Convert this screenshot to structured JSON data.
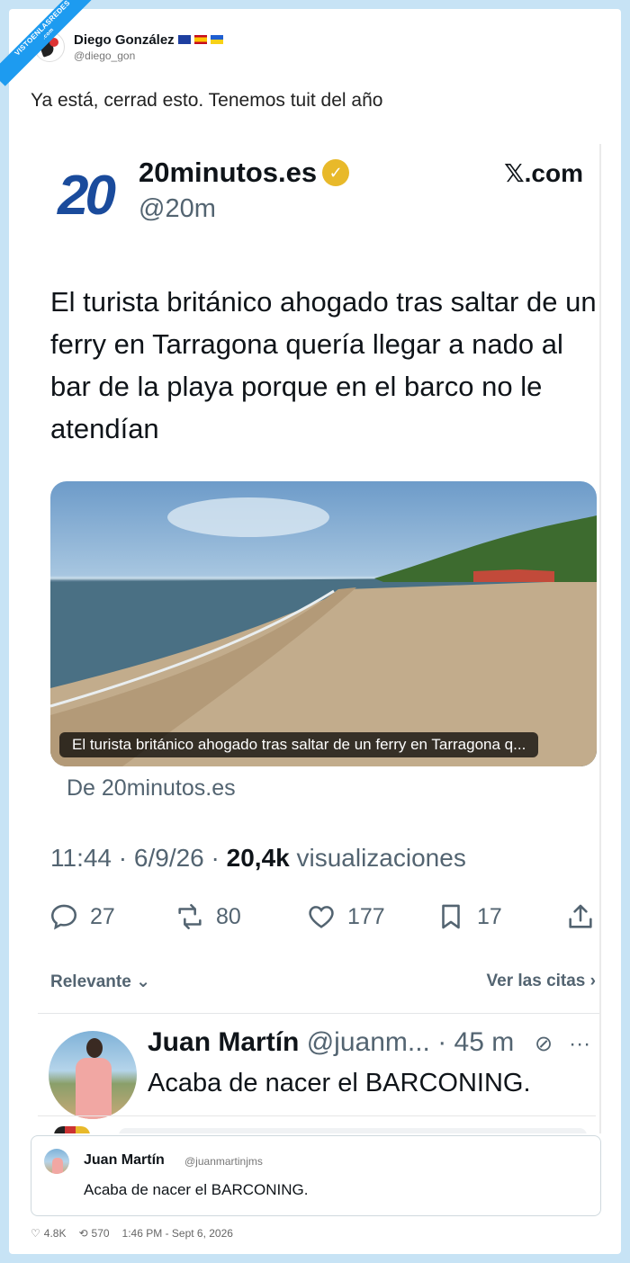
{
  "watermark": {
    "line1": "VISTOENLASREDES",
    "line2": ".com"
  },
  "outer_tweet": {
    "author_name": "Diego González",
    "author_handle": "@diego_gon",
    "text": "Ya está, cerrad esto. Tenemos tuit del año"
  },
  "embedded": {
    "logo_text": "20",
    "source_name": "20minutos.es",
    "source_handle": "@20m",
    "brand": "𝕏.com",
    "headline": "El turista británico ahogado tras saltar de un ferry en Tarragona quería llegar a nado al bar de la playa porque en el barco no le atendían",
    "image_caption": "El turista británico ahogado tras saltar de un ferry en Tarragona q...",
    "from_label": "De 20minutos.es",
    "meta": {
      "time": "11:44",
      "date": "6/9/26",
      "views_count": "20,4k",
      "views_label": "visualizaciones",
      "sep": "·"
    },
    "actions": {
      "replies": "27",
      "retweets": "80",
      "likes": "177",
      "bookmarks": "17"
    },
    "sort_label": "Relevante",
    "quotes_link": "Ver las citas",
    "reply": {
      "name": "Juan Martín",
      "handle": "@juanm...",
      "time": "· 45 m",
      "text": "Acaba de nacer el BARCONING."
    }
  },
  "quote_card": {
    "name": "Juan Martín",
    "handle": "@juanmartinjms",
    "text": "Acaba de nacer el BARCONING."
  },
  "footer": {
    "likes": "4.8K",
    "retweets": "570",
    "timestamp": "1:46 PM - Sept 6, 2026"
  },
  "colors": {
    "background": "#c7e3f5",
    "accent": "#1d9bf0",
    "logo_blue": "#1a4b9c",
    "verified_gold": "#e8b92a",
    "muted": "#536471"
  }
}
